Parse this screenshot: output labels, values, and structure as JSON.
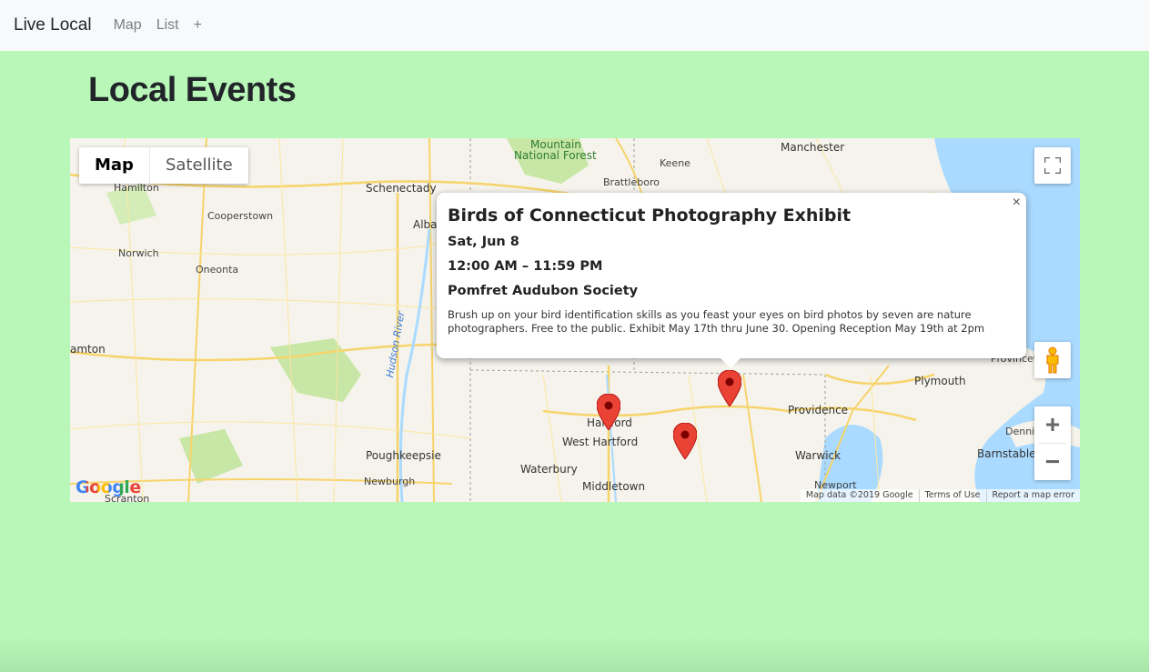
{
  "navbar": {
    "brand": "Live Local",
    "links": [
      "Map",
      "List",
      "+"
    ]
  },
  "page": {
    "title": "Local Events"
  },
  "map": {
    "type_controls": {
      "active": "Map",
      "inactive": "Satellite"
    },
    "infowindow": {
      "title": "Birds of Connecticut Photography Exhibit",
      "date": "Sat, Jun 8",
      "time": "12:00 AM – 11:59 PM",
      "organizer": "Pomfret Audubon Society",
      "description": "Brush up on your bird identification skills as you feast your eyes on bird photos by seven are nature photographers. Free to the public. Exhibit May 17th thru June 30. Opening Reception May 19th at 2pm",
      "close": "×"
    },
    "zoom": {
      "in": "+",
      "out": "−"
    },
    "logo": "Google",
    "attribution": [
      "Map data ©2019 Google",
      "Terms of Use",
      "Report a map error"
    ],
    "place_labels": [
      "Mountain",
      "National Forest",
      "Manchester",
      "Keene",
      "Brattleboro",
      "Hamilton",
      "Schenectady",
      "Cooperstown",
      "Alba",
      "Norwich",
      "Oneonta",
      "amton",
      "Hudson River",
      "Poughkeepsie",
      "Newburgh",
      "Hartford",
      "West Hartford",
      "Waterbury",
      "Middletown",
      "Providence",
      "Warwick",
      "Plymouth",
      "Provincet",
      "Dennis",
      "Barnstable",
      "Newport",
      "Scranton"
    ],
    "colors": {
      "marker": "#ea4335",
      "water": "#aadaff",
      "road": "#fde293",
      "land": "#f5f3ec",
      "park": "#c8e6a5"
    }
  }
}
